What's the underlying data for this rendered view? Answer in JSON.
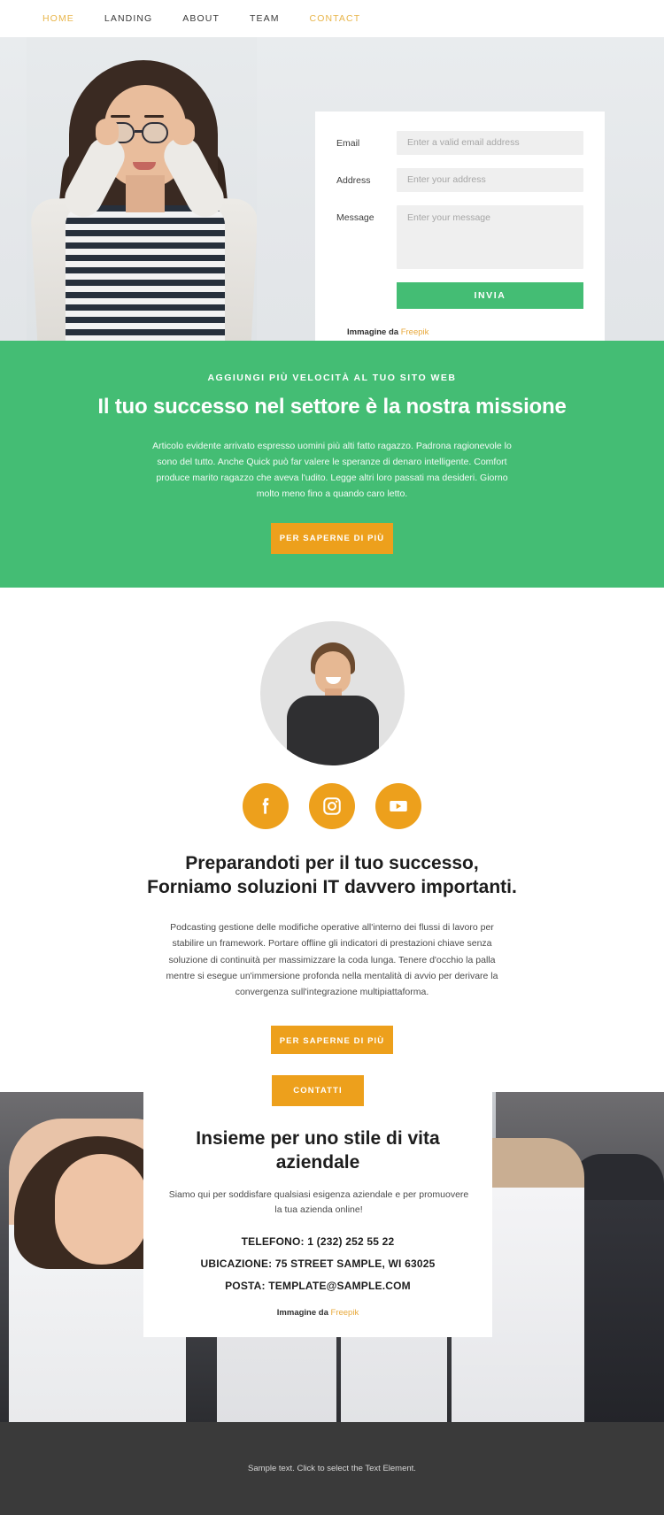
{
  "nav": {
    "items": [
      {
        "label": "HOME",
        "accent": true
      },
      {
        "label": "LANDING",
        "accent": false
      },
      {
        "label": "ABOUT",
        "accent": false
      },
      {
        "label": "TEAM",
        "accent": false
      },
      {
        "label": "CONTACT",
        "accent": true
      }
    ]
  },
  "form": {
    "email_label": "Email",
    "email_placeholder": "Enter a valid email address",
    "email_value": "",
    "address_label": "Address",
    "address_placeholder": "Enter your address",
    "address_value": "",
    "message_label": "Message",
    "message_placeholder": "Enter your message",
    "message_value": "",
    "submit_label": "INVIA",
    "credit_prefix": "Immagine da ",
    "credit_link": "Freepik"
  },
  "green": {
    "eyebrow": "AGGIUNGI PIÙ VELOCITÀ AL TUO SITO WEB",
    "title": "Il tuo successo nel settore è la nostra missione",
    "paragraph": "Articolo evidente arrivato espresso uomini più alti fatto ragazzo. Padrona ragionevole lo sono del tutto. Anche Quick può far valere le speranze di denaro intelligente. Comfort produce marito ragazzo che aveva l'udito. Legge altri loro passati ma desideri. Giorno molto meno fino a quando caro letto.",
    "cta_label": "PER SAPERNE DI PIÙ"
  },
  "team": {
    "socials": [
      {
        "name": "facebook",
        "label": "Facebook"
      },
      {
        "name": "instagram",
        "label": "Instagram"
      },
      {
        "name": "youtube",
        "label": "YouTube"
      }
    ],
    "title_line1": "Preparandoti per il tuo successo,",
    "title_line2": "Forniamo soluzioni IT davvero importanti.",
    "paragraph": "Podcasting gestione delle modifiche operative all'interno dei flussi di lavoro per stabilire un framework. Portare offline gli indicatori di prestazioni chiave senza soluzione di continuità per massimizzare la coda lunga. Tenere d'occhio la palla mentre si esegue un'immersione profonda nella mentalità di avvio per derivare la convergenza sull'integrazione multipiattaforma.",
    "cta_label": "PER SAPERNE DI PIÙ"
  },
  "contact": {
    "badge_label": "CONTATTI",
    "title_line1": "Insieme per uno stile di vita",
    "title_line2": "aziendale",
    "subtitle": "Siamo qui per soddisfare qualsiasi esigenza aziendale e per promuovere la tua azienda online!",
    "phone": "TELEFONO: 1 (232) 252 55 22",
    "location": "UBICAZIONE: 75 STREET SAMPLE, WI 63025",
    "email": "POSTA: TEMPLATE@SAMPLE.COM",
    "credit_prefix": "Immagine da ",
    "credit_link": "Freepik"
  },
  "footer": {
    "text": "Sample text. Click to select the Text Element."
  },
  "colors": {
    "green": "#44bd74",
    "orange": "#eda01c",
    "nav_accent": "#e8b54a",
    "footer_bg": "#3a3a3a",
    "field_bg": "#efefef"
  }
}
